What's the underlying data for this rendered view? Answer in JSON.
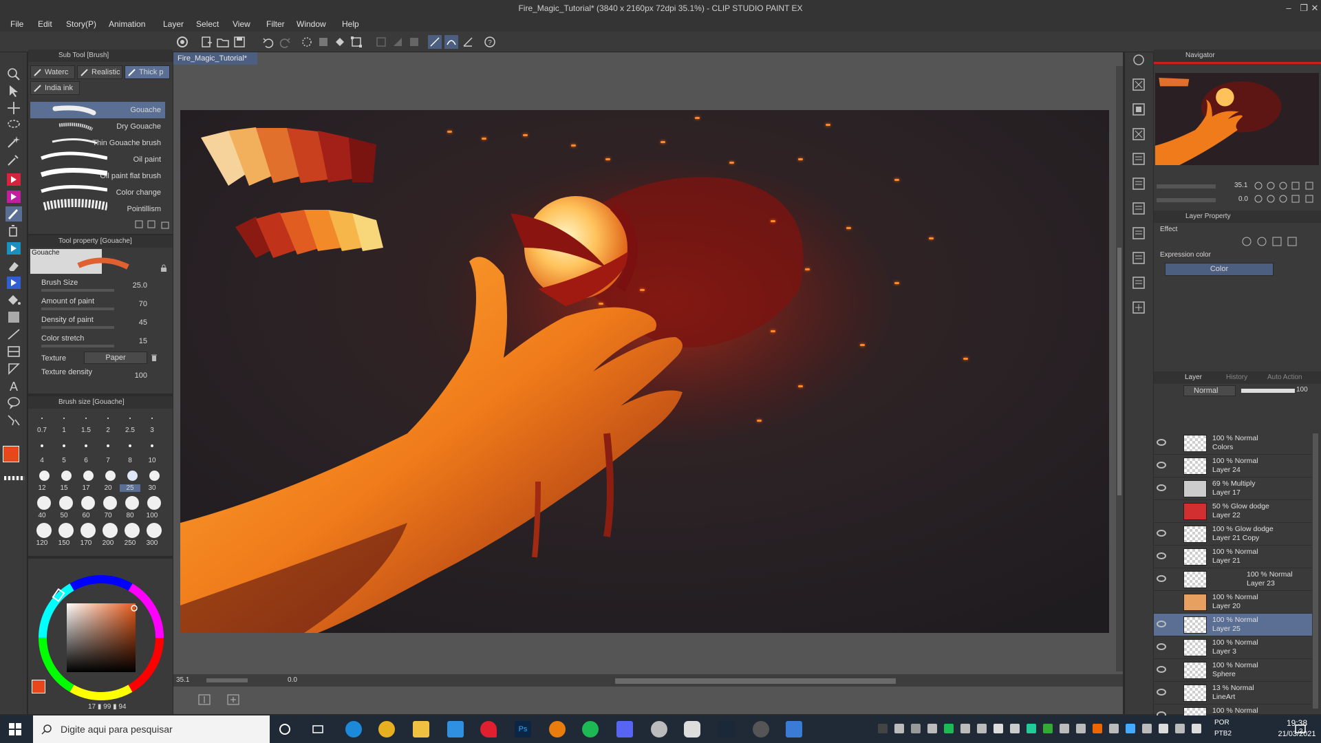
{
  "window": {
    "title": "Fire_Magic_Tutorial* (3840 x 2160px 72dpi 35.1%) - CLIP STUDIO PAINT EX",
    "minimize": "–",
    "maximize": "❐",
    "close": "✕"
  },
  "menu": [
    "File",
    "Edit",
    "Story(P)",
    "Animation",
    "Layer",
    "Select",
    "View",
    "Filter",
    "Window",
    "Help"
  ],
  "subtool": {
    "header": "Sub Tool [Brush]",
    "tabs": [
      "Waterc",
      "Realistic",
      "Thick p",
      "India ink"
    ],
    "brushes": [
      "Gouache",
      "Dry Gouache",
      "Thin Gouache brush",
      "Oil paint",
      "Oil paint flat brush",
      "Color change",
      "Pointillism"
    ],
    "selected": "Gouache"
  },
  "tool_property": {
    "header": "Tool property [Gouache]",
    "preview_label": "Gouache",
    "brush_size_label": "Brush Size",
    "brush_size": "25.0",
    "amount_label": "Amount of paint",
    "amount": "70",
    "density_label": "Density of paint",
    "density": "45",
    "stretch_label": "Color stretch",
    "stretch": "15",
    "texture_label": "Texture",
    "texture_value": "Paper",
    "texture_density_label": "Texture density",
    "texture_density": "100"
  },
  "brush_size_panel": {
    "header": "Brush size [Gouache]",
    "rows": [
      [
        "0.7",
        "1",
        "1.5",
        "2",
        "2.5",
        "3"
      ],
      [
        "4",
        "5",
        "6",
        "7",
        "8",
        "10"
      ],
      [
        "12",
        "15",
        "17",
        "20",
        "25",
        "30"
      ],
      [
        "40",
        "50",
        "60",
        "70",
        "80",
        "100"
      ],
      [
        "120",
        "150",
        "170",
        "200",
        "250",
        "300"
      ]
    ],
    "selected": "25"
  },
  "color_wheel": {
    "readout": "17 ▮ 99 ▮ 94",
    "main_color": "#e8471a",
    "sub_color": "#8b1a10"
  },
  "canvas": {
    "doc_tab": "Fire_Magic_Tutorial*",
    "zoom": "35.1",
    "rotation": "0.0"
  },
  "navigator": {
    "header": "Navigator",
    "zoom": "35.1",
    "rotation": "0.0"
  },
  "layer_property": {
    "header": "Layer Property",
    "effect_label": "Effect",
    "expression_label": "Expression color",
    "expression_value": "Color"
  },
  "layers": {
    "tabs": [
      "Layer",
      "History",
      "Auto Action"
    ],
    "blend_mode": "Normal",
    "opacity": "100",
    "items": [
      {
        "mode": "100 % Normal",
        "name": "Colors",
        "visible": true,
        "selected": false
      },
      {
        "mode": "100 % Normal",
        "name": "Layer 24",
        "visible": true,
        "selected": false
      },
      {
        "mode": "69 % Multiply",
        "name": "Layer 17",
        "visible": true,
        "selected": false
      },
      {
        "mode": "50 % Glow dodge",
        "name": "Layer 22",
        "visible": false,
        "selected": false
      },
      {
        "mode": "100 % Glow dodge",
        "name": "Layer 21 Copy",
        "visible": true,
        "selected": false
      },
      {
        "mode": "100 % Normal",
        "name": "Layer 21",
        "visible": true,
        "selected": false
      },
      {
        "mode": "100 % Normal",
        "name": "Layer 23",
        "visible": true,
        "selected": false
      },
      {
        "mode": "100 % Normal",
        "name": "Layer 20",
        "visible": false,
        "selected": false
      },
      {
        "mode": "100 % Normal",
        "name": "Layer 25",
        "visible": true,
        "selected": true
      },
      {
        "mode": "100 % Normal",
        "name": "Layer 3",
        "visible": true,
        "selected": false
      },
      {
        "mode": "100 % Normal",
        "name": "Sphere",
        "visible": true,
        "selected": false
      },
      {
        "mode": "13 % Normal",
        "name": "LineArt",
        "visible": true,
        "selected": false
      },
      {
        "mode": "100 % Normal",
        "name": "",
        "visible": true,
        "selected": false
      }
    ]
  },
  "taskbar": {
    "search_placeholder": "Digite aqui para pesquisar",
    "lang": "POR",
    "lang2": "PTB2",
    "time": "19:38",
    "date": "21/03/2021",
    "notifications": "2"
  }
}
